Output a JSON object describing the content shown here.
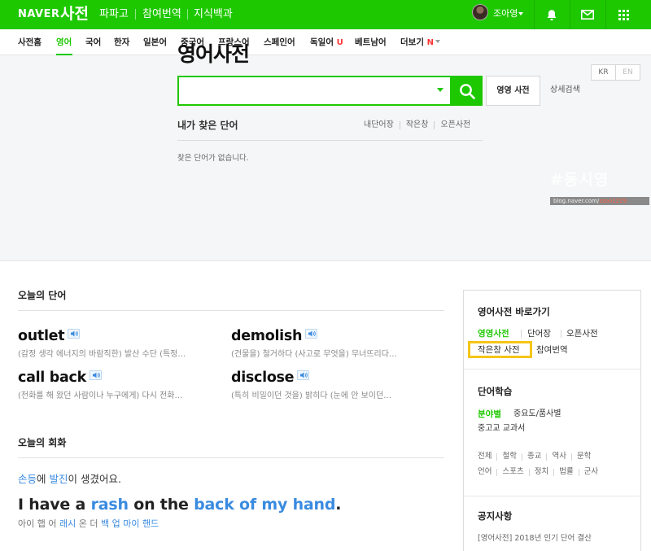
{
  "topbar": {
    "logo": "NAVER",
    "brand": "사전",
    "links": [
      "파파고",
      "참여번역",
      "지식백과"
    ],
    "user_name": "조아영",
    "icons": [
      "bell-icon",
      "mail-icon",
      "grid-menu-icon"
    ]
  },
  "subnav": {
    "tabs": [
      "사전홈",
      "영어",
      "국어",
      "한자",
      "일본어",
      "중국어",
      "프랑스어",
      "스페인어",
      "독일어",
      "베트남어",
      "더보기"
    ],
    "active_tab": "영어",
    "new_badge": "U",
    "more_badge": "N"
  },
  "hero": {
    "lang_kr": "KR",
    "lang_en": "EN",
    "title": "영어사전",
    "search_value": "",
    "en_en_button": "영영 사전",
    "detail_search": "상세검색",
    "recent_title": "내가 찾은 단어",
    "recent_links": [
      "내단어장",
      "작은창",
      "오픈사전"
    ],
    "recent_empty": "찾은 단어가 없습니다.",
    "watermark": "#동시영",
    "watermark_url": "blog.naver.com/",
    "watermark_id": "zzoo1229"
  },
  "today_words": {
    "title": "오늘의 단어",
    "items": [
      {
        "word": "outlet",
        "def": "(감정 생각 에너지의 바람직한) 발산 수단 (특정…"
      },
      {
        "word": "demolish",
        "def": "(건물을) 철거하다 (사고로 무엇을) 무너뜨리다…"
      },
      {
        "word": "call back",
        "def": "(전화를 해 왔던 사람이나 누구에게) 다시 전화…"
      },
      {
        "word": "disclose",
        "def": "(특히 비밀이던 것을) 밝히다 (눈에 안 보이던…"
      }
    ]
  },
  "today_conversation": {
    "title": "오늘의 회화",
    "ko_parts": [
      {
        "text": "손등",
        "hl": true
      },
      {
        "text": "에 ",
        "hl": false
      },
      {
        "text": "발진",
        "hl": true
      },
      {
        "text": "이 생겼어요.",
        "hl": false
      }
    ],
    "en_parts": [
      {
        "text": "I have a ",
        "hl": false
      },
      {
        "text": "rash",
        "hl": true
      },
      {
        "text": " on the ",
        "hl": false
      },
      {
        "text": "back of my hand",
        "hl": true
      },
      {
        "text": ".",
        "hl": false
      }
    ],
    "pron_parts": [
      {
        "text": "아이 햅 어 ",
        "hl": false
      },
      {
        "text": "래시",
        "hl": true
      },
      {
        "text": " 온 더 ",
        "hl": false
      },
      {
        "text": "백 업 마이 핸드",
        "hl": true
      }
    ]
  },
  "sidebar": {
    "shortcut_title": "영어사전 바로가기",
    "shortcut_links": [
      "영영사전",
      "단어장",
      "오픈사전",
      "작은창 사전",
      "참여번역"
    ],
    "study_title": "단어학습",
    "study_links": [
      "분야별",
      "중요도/품사별",
      "중고교 교과서"
    ],
    "categories_row1": [
      "전체",
      "철학",
      "종교",
      "역사",
      "문학"
    ],
    "categories_row2": [
      "언어",
      "스포츠",
      "정치",
      "법률",
      "군사"
    ],
    "notice_title": "공지사항",
    "notice_item": "[영어사전] 2018년 인기 단어 결산"
  },
  "colors": {
    "naver_green": "#1ec800",
    "highlight_blue": "#3a8be0",
    "focus_yellow": "#f5c518"
  }
}
